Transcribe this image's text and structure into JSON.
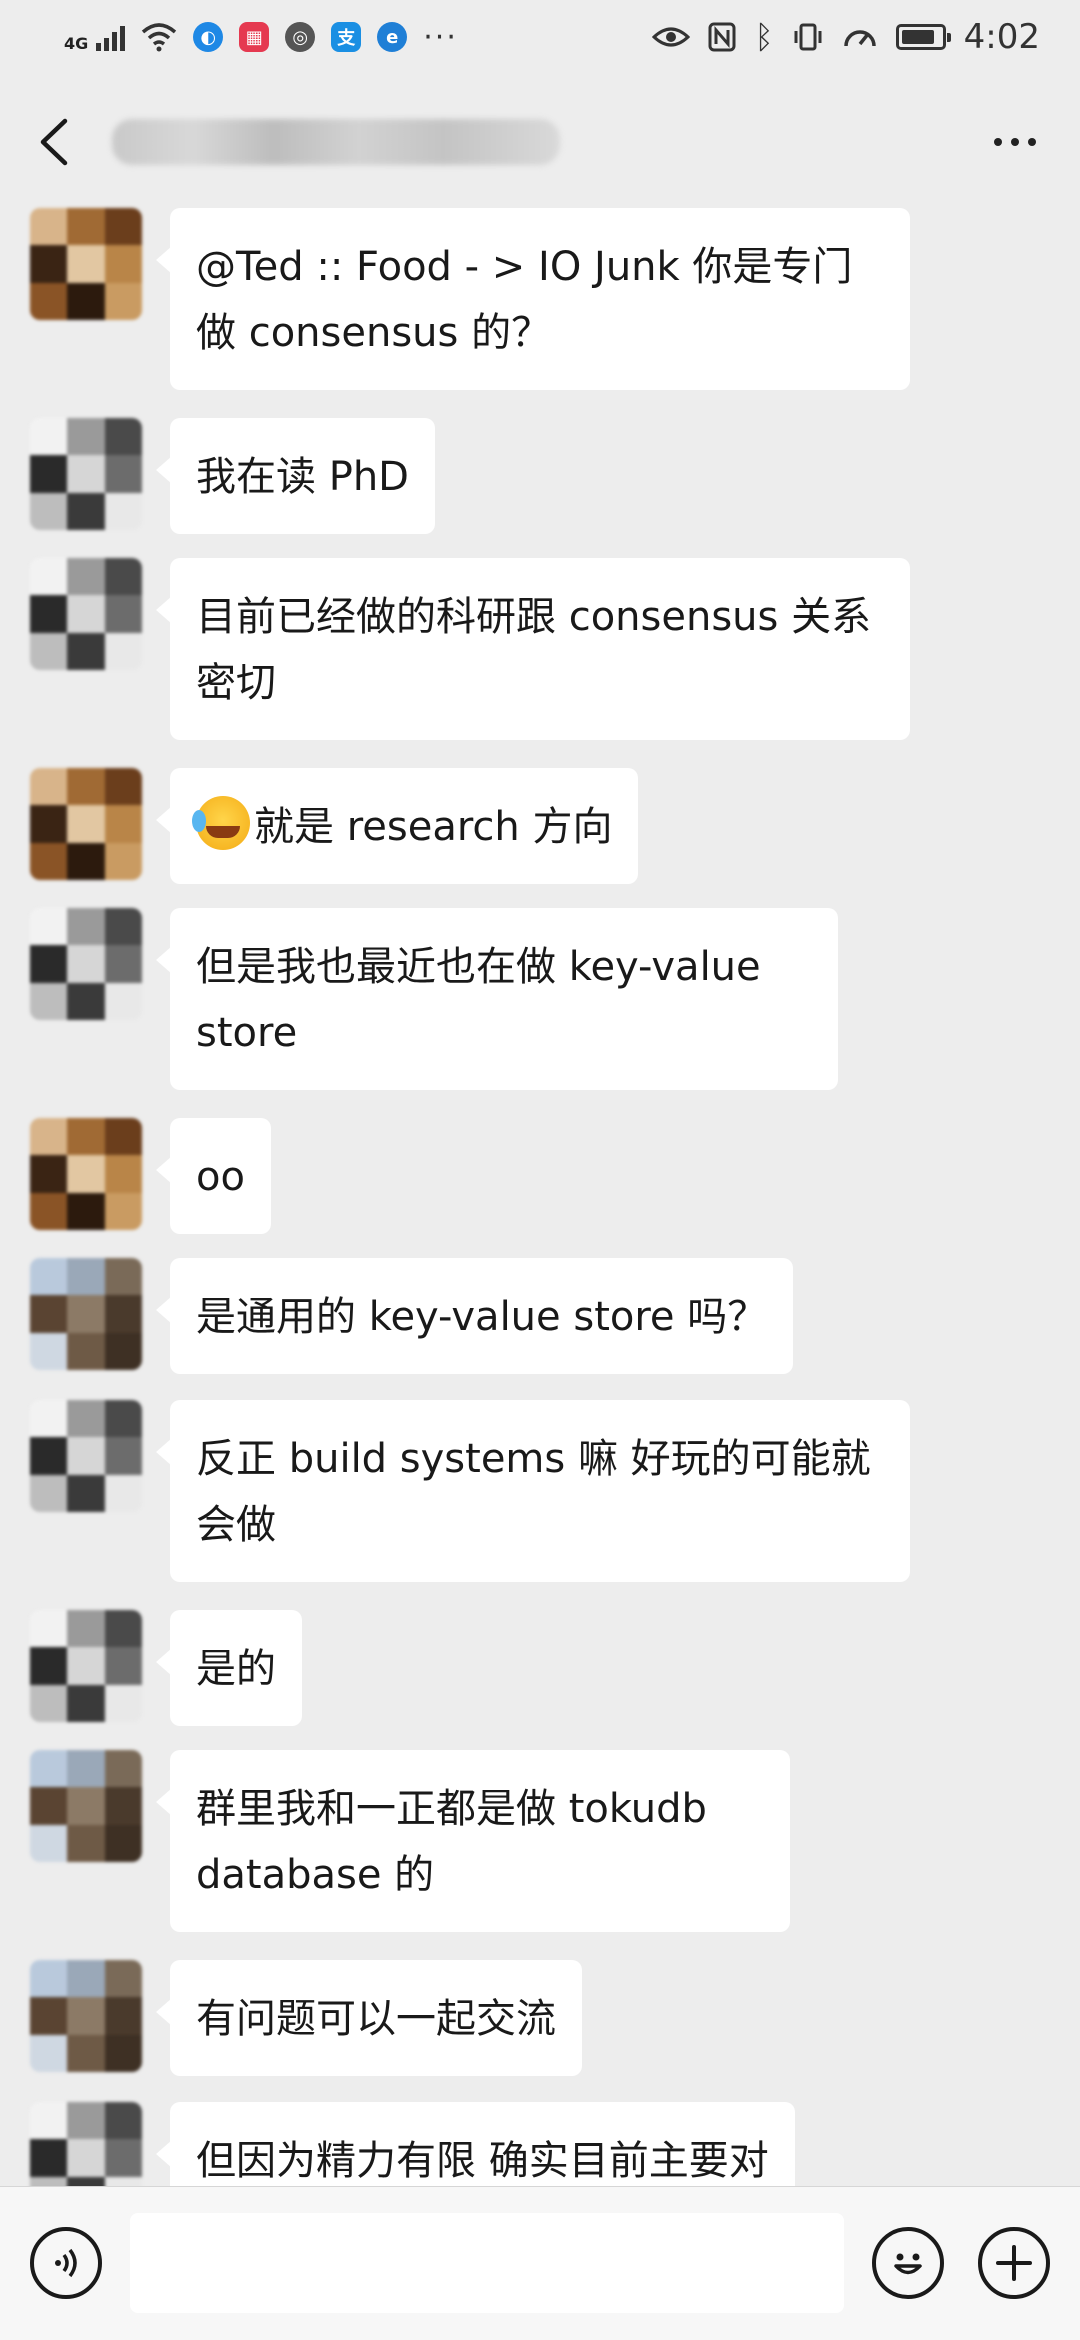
{
  "status_bar": {
    "network_type": "4G",
    "time": "4:02",
    "left_icons": [
      "signal-icon",
      "wifi-icon",
      "app-notification-icon",
      "calendar-app-icon",
      "browser-app-icon",
      "alipay-icon",
      "edge-app-icon",
      "more-notifications-icon"
    ],
    "right_icons": [
      "eye-comfort-icon",
      "nfc-icon",
      "bluetooth-icon",
      "vibrate-icon",
      "data-speed-icon",
      "battery-icon"
    ],
    "battery_level": 0.85
  },
  "title_bar": {
    "title_obscured": true
  },
  "messages": [
    {
      "id": 1,
      "text": "@Ted :: Food - >  IO Junk  你是专门做 consensus 的？",
      "avatar": "a"
    },
    {
      "id": 2,
      "text": "我在读 PhD",
      "avatar": "b"
    },
    {
      "id": 3,
      "text": "目前已经做的科研跟 consensus 关系密切",
      "avatar": "b"
    },
    {
      "id": 4,
      "text": "就是 research 方向",
      "avatar": "a",
      "emoji": "facepalm-laugh-emoji"
    },
    {
      "id": 5,
      "text": "但是我也最近也在做 key-value store",
      "avatar": "b"
    },
    {
      "id": 6,
      "text": "oo",
      "avatar": "a"
    },
    {
      "id": 7,
      "text": "是通用的 key-value store 吗？",
      "avatar": "c"
    },
    {
      "id": 8,
      "text": "反正 build systems 嘛 好玩的可能就会做",
      "avatar": "b"
    },
    {
      "id": 9,
      "text": "是的",
      "avatar": "b"
    },
    {
      "id": 10,
      "text": "群里我和一正都是做 tokudb database 的",
      "avatar": "c"
    },
    {
      "id": 11,
      "text": "有问题可以一起交流",
      "avatar": "c"
    },
    {
      "id": 12,
      "text": "但因为精力有限 确实目前主要对",
      "avatar": "b"
    }
  ],
  "input_bar": {
    "placeholder": "",
    "value": ""
  },
  "colors": {
    "background": "#ededed",
    "bubble": "#ffffff",
    "input_bar": "#f7f7f7",
    "text": "#191919"
  }
}
